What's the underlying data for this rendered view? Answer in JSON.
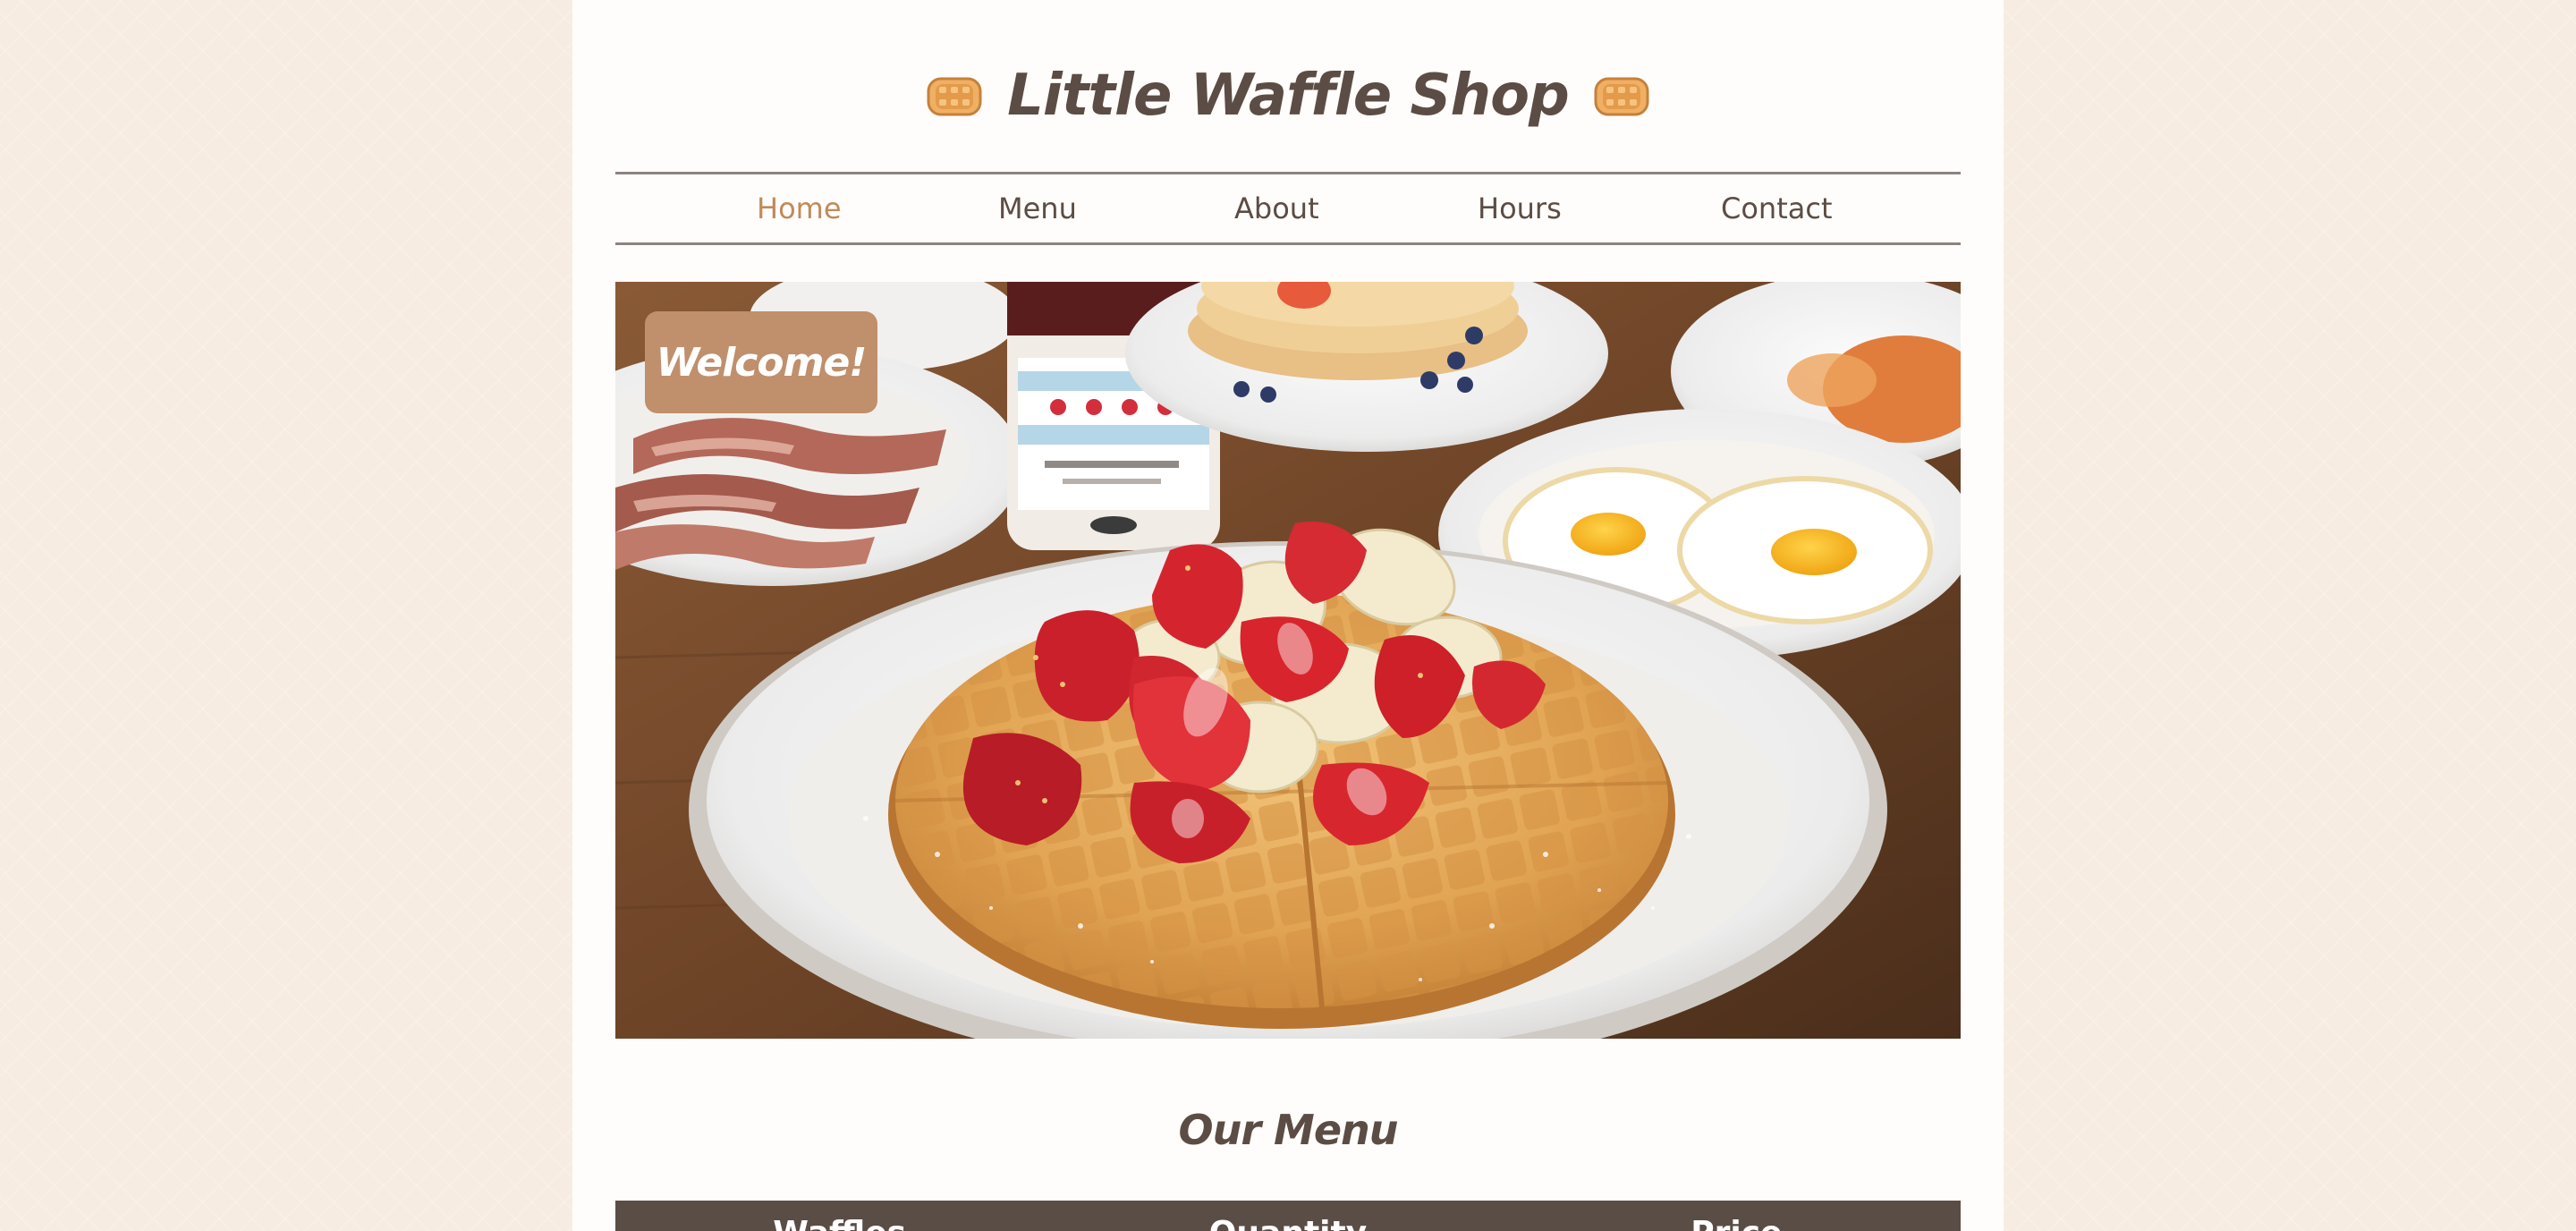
{
  "header": {
    "title": "Little Waffle Shop",
    "left_icon": "waffle-icon",
    "right_icon": "waffle-icon"
  },
  "nav": {
    "items": [
      {
        "label": "Home",
        "active": true
      },
      {
        "label": "Menu",
        "active": false
      },
      {
        "label": "About",
        "active": false
      },
      {
        "label": "Hours",
        "active": false
      },
      {
        "label": "Contact",
        "active": false
      }
    ]
  },
  "hero": {
    "badge": "Welcome!"
  },
  "menu_section": {
    "title": "Our Menu",
    "columns": [
      "Waffles",
      "Quantity",
      "Price"
    ]
  },
  "colors": {
    "background": "#f7ece1",
    "page": "#fffdfb",
    "text": "#5b4d45",
    "accent": "#c08a5a",
    "badge": "#c08f6c",
    "table_header": "#5a4d46"
  }
}
